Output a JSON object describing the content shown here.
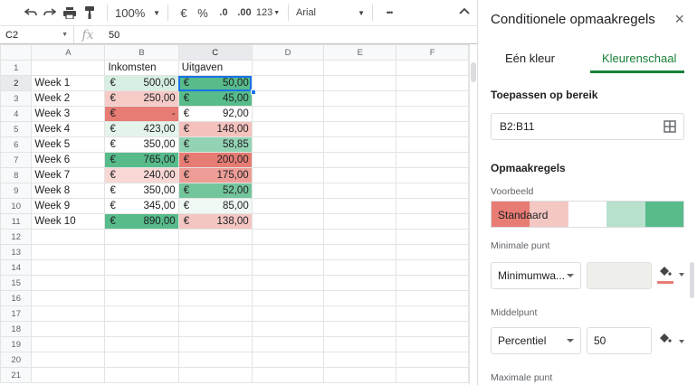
{
  "toolbar": {
    "zoom": "100%",
    "currency": "€",
    "percent": "%",
    "decrease_decimals": ".0",
    "increase_decimals": ".00",
    "format_more": "123",
    "font": "Arial",
    "more": "•••"
  },
  "formula_bar": {
    "cell_ref": "C2",
    "fx": "fx",
    "value": "50"
  },
  "sheet": {
    "columns": [
      "A",
      "B",
      "C",
      "D",
      "E",
      "F"
    ],
    "header_row": {
      "b": "Inkomsten",
      "c": "Uitgaven"
    },
    "rows": [
      {
        "n": "1"
      },
      {
        "n": "2",
        "week": "Week 1",
        "inc": "500,00",
        "exp": "50,00"
      },
      {
        "n": "3",
        "week": "Week 2",
        "inc": "250,00",
        "exp": "45,00"
      },
      {
        "n": "4",
        "week": "Week 3",
        "inc": "-",
        "exp": "92,00"
      },
      {
        "n": "5",
        "week": "Week 4",
        "inc": "423,00",
        "exp": "148,00"
      },
      {
        "n": "6",
        "week": "Week 5",
        "inc": "350,00",
        "exp": "58,85"
      },
      {
        "n": "7",
        "week": "Week 6",
        "inc": "765,00",
        "exp": "200,00"
      },
      {
        "n": "8",
        "week": "Week 7",
        "inc": "240,00",
        "exp": "175,00"
      },
      {
        "n": "9",
        "week": "Week 8",
        "inc": "350,00",
        "exp": "52,00"
      },
      {
        "n": "10",
        "week": "Week 9",
        "inc": "345,00",
        "exp": "85,00"
      },
      {
        "n": "11",
        "week": "Week 10",
        "inc": "890,00",
        "exp": "138,00"
      },
      {
        "n": "12"
      },
      {
        "n": "13"
      },
      {
        "n": "14"
      },
      {
        "n": "15"
      },
      {
        "n": "16"
      },
      {
        "n": "17"
      },
      {
        "n": "18"
      },
      {
        "n": "19"
      },
      {
        "n": "20"
      },
      {
        "n": "21"
      }
    ],
    "currency_symbol": "€",
    "colors": {
      "inc": [
        "",
        "#d7efe2",
        "#f6cbc7",
        "#e67c73",
        "#e4f4eb",
        "#ffffff",
        "#57bb8a",
        "#f8d7d4",
        "#ffffff",
        "#ffffff",
        "#57bb8a"
      ],
      "exp": [
        "",
        "#57bb8a",
        "#57bb8a",
        "#ffffff",
        "#f4c1bc",
        "#93d3b4",
        "#e67c73",
        "#ee9d96",
        "#73c59c",
        "#f0f8f4",
        "#f4c6c1"
      ]
    }
  },
  "panel": {
    "title": "Conditionele opmaakregels",
    "close_icon": "×",
    "tab_single": "Eén kleur",
    "tab_scale": "Kleurenschaal",
    "apply_range_label": "Toepassen op bereik",
    "range_value": "B2:B11",
    "rules_label": "Opmaakregels",
    "preview_label": "Voorbeeld",
    "preview_text": "Standaard",
    "preview_colors": [
      "#e67c73",
      "#f4c7c3",
      "#ffffff",
      "#b7e1cd",
      "#57bb8a"
    ],
    "min_label": "Minimale punt",
    "min_select": "Minimumwa...",
    "min_color": "#e67c73",
    "mid_label": "Middelpunt",
    "mid_select": "Percentiel",
    "mid_value": "50",
    "max_label": "Maximale punt"
  }
}
